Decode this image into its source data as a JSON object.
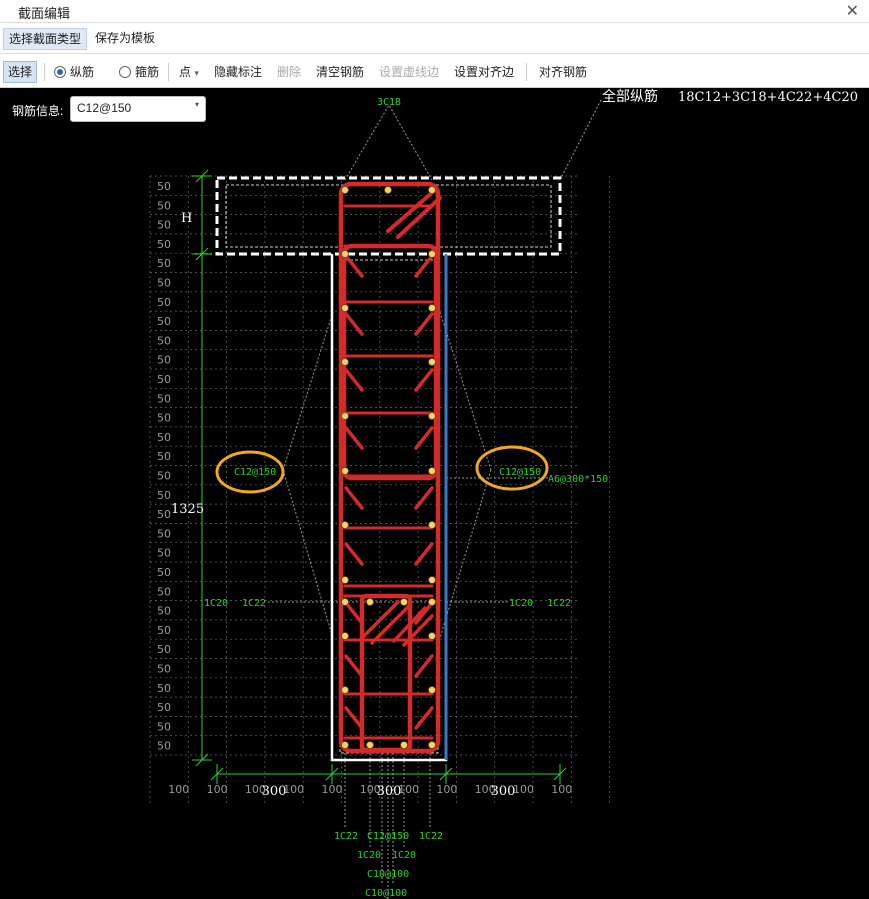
{
  "window": {
    "title": "截面编辑",
    "close_glyph": "✕"
  },
  "menubar": {
    "items": [
      "选择截面类型",
      "保存为模板"
    ]
  },
  "toolbar": {
    "select": "选择",
    "longitudinal": "纵筋",
    "stirrup": "箍筋",
    "point": "点",
    "point_arrow": "▾",
    "hide_label": "隐藏标注",
    "delete": "删除",
    "clear_rebar": "清空钢筋",
    "set_virtual_edge": "设置虚线边",
    "set_align_edge": "设置对齐边",
    "align_rebar": "对齐钢筋",
    "mode_selected": "longitudinal"
  },
  "rebar_info": {
    "label": "钢筋信息:",
    "value": "C12@150",
    "arrow": "▾"
  },
  "drawing": {
    "total_label": "全部纵筋",
    "total_value": "18C12+3C18+4C22+4C20",
    "top_label": "3C18",
    "h_label": "H",
    "height_label": "1325",
    "left_dist": "C12@150",
    "right_dist": "C12@150",
    "stirrup_label": "A6@300*150",
    "left_c20": "1C20",
    "left_c22": "1C22",
    "right_c20": "1C20",
    "right_c22": "1C22",
    "dims_bottom": [
      "300",
      "300",
      "300"
    ],
    "grid_left": "50",
    "grid_bottom": "100",
    "bottom_labels": {
      "c22_left": "1C22",
      "c12_150": "C12@150",
      "c22_right": "1C22",
      "c20_left": "1C20",
      "c20_right": "1C20",
      "c10_a": "C10@100",
      "c10_b": "C10@100"
    },
    "colors": {
      "rebar": "#d42a2a",
      "annotation": "#2bd42b",
      "outline": "#ffffff",
      "highlight": "#f0a81c",
      "blue_edge": "#2d7bd6",
      "grid": "#6a6a6a"
    }
  }
}
